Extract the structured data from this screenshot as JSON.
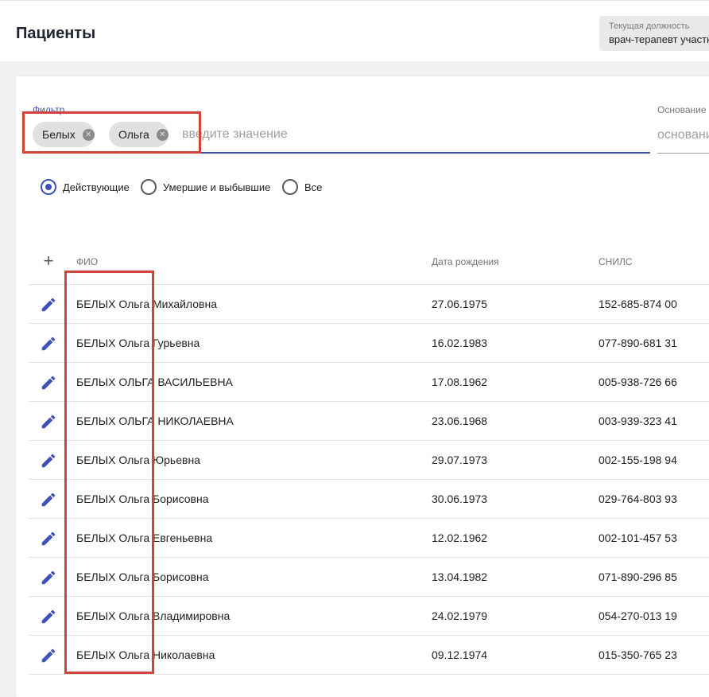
{
  "header": {
    "title": "Пациенты",
    "position_label": "Текущая должность",
    "position_value": "врач-терапевт участковый"
  },
  "filter": {
    "label": "Фильтр",
    "chips": [
      "Белых",
      "Ольга"
    ],
    "placeholder": "введите значение"
  },
  "basis": {
    "label": "Основание",
    "placeholder": "основание"
  },
  "status_filter": {
    "options": [
      "Действующие",
      "Умершие и выбывшие",
      "Все"
    ],
    "selected": "Действующие"
  },
  "table": {
    "columns": [
      "ФИО",
      "Дата рождения",
      "СНИЛС"
    ],
    "rows": [
      {
        "name": "БЕЛЫХ Ольга Михайловна",
        "dob": "27.06.1975",
        "snils": "152-685-874 00"
      },
      {
        "name": "БЕЛЫХ Ольга Гурьевна",
        "dob": "16.02.1983",
        "snils": "077-890-681 31"
      },
      {
        "name": "БЕЛЫХ ОЛЬГА ВАСИЛЬЕВНА",
        "dob": "17.08.1962",
        "snils": "005-938-726 66"
      },
      {
        "name": "БЕЛЫХ ОЛЬГА НИКОЛАЕВНА",
        "dob": "23.06.1968",
        "snils": "003-939-323 41"
      },
      {
        "name": "БЕЛЫХ Ольга Юрьевна",
        "dob": "29.07.1973",
        "snils": "002-155-198 94"
      },
      {
        "name": "БЕЛЫХ Ольга Борисовна",
        "dob": "30.06.1973",
        "snils": "029-764-803 93"
      },
      {
        "name": "БЕЛЫХ Ольга Евгеньевна",
        "dob": "12.02.1962",
        "snils": "002-101-457 53"
      },
      {
        "name": "БЕЛЫХ Ольга Борисовна",
        "dob": "13.04.1982",
        "snils": "071-890-296 85"
      },
      {
        "name": "БЕЛЫХ Ольга Владимировна",
        "dob": "24.02.1979",
        "snils": "054-270-013 19"
      },
      {
        "name": "БЕЛЫХ Ольга Николаевна",
        "dob": "09.12.1974",
        "snils": "015-350-765 23"
      }
    ]
  },
  "icons": {
    "add": "plus-icon",
    "edit": "pencil-icon",
    "chip_remove": "close-circle-icon"
  },
  "colors": {
    "accent": "#3f51b5",
    "highlight": "#d0453b"
  }
}
